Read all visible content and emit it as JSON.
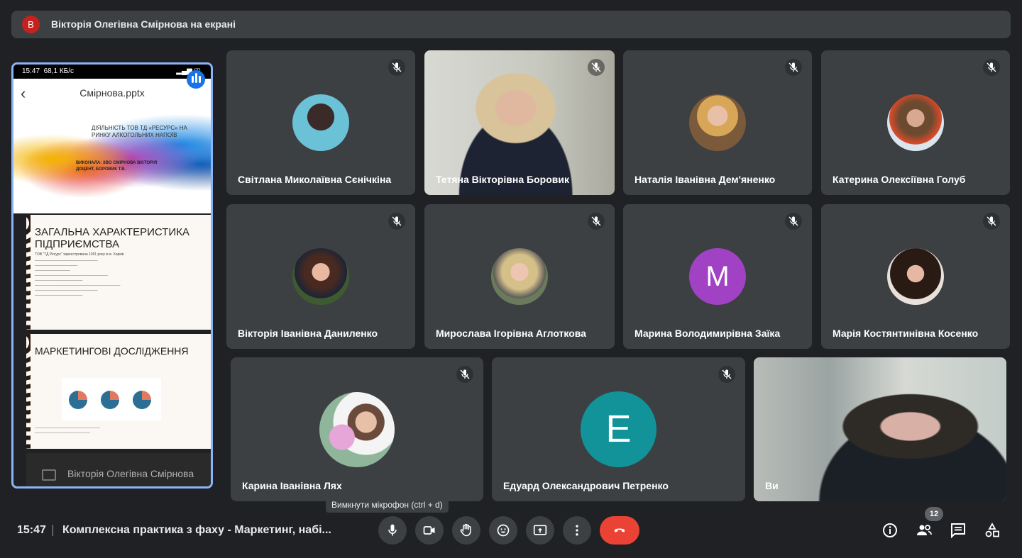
{
  "banner": {
    "avatar_letter": "В",
    "title": "Вікторія Олегівна Смірнова на екрані"
  },
  "presenter": {
    "phone_time": "15:47",
    "phone_speed": "68,1 КБ/с",
    "file_name": "Смірнова.pptx",
    "slide1_title": "ДІЯЛЬНІСТЬ ТОВ ТД «РЕСУРС» НА РИНКУ АЛКОГОЛЬНИХ НАПОЇВ",
    "slide1_author": "ВИКОНАЛА: ЗВО СМІРНОВА ВІКТОРІЯ ДОЦЕНТ, БОРОВИК Т.В.",
    "slide2_title": "ЗАГАЛЬНА ХАРАКТЕРИСТИКА ПІДПРИЄМСТВА",
    "slide2_text": "ТОВ \"ТД Ресурс\" зареєстрована 1991 року в м. Харків",
    "slide3_title": "МАРКЕТИНГОВІ ДОСЛІДЖЕННЯ",
    "name": "Вікторія Олегівна Смірнова"
  },
  "participants": [
    {
      "name": "Світлана Миколаївна Сєнічкіна",
      "avatar": "photo",
      "color": "#4a90a4"
    },
    {
      "name": "Тетяна Вікторівна Боровик",
      "avatar": "video",
      "color": "#c9b9a1"
    },
    {
      "name": "Наталія Іванівна Дем'яненко",
      "avatar": "photo",
      "color": "#d8a657"
    },
    {
      "name": "Катерина Олексіївна Голуб",
      "avatar": "photo",
      "color": "#8a6d52"
    },
    {
      "name": "Вікторія Іванівна Даниленко",
      "avatar": "photo",
      "color": "#3e5b2f"
    },
    {
      "name": "Мирослава Ігорівна Аглоткова",
      "avatar": "photo",
      "color": "#cbb9a0"
    },
    {
      "name": "Марина Володимирівна Заїка",
      "avatar": "letter",
      "letter": "М",
      "color": "#a142c4"
    },
    {
      "name": "Марія Костянтинівна Косенко",
      "avatar": "photo",
      "color": "#4d3b32"
    },
    {
      "name": "Карина Іванівна Лях",
      "avatar": "photo",
      "color": "#8fb59a"
    },
    {
      "name": "Едуард Олександрович Петренко",
      "avatar": "letter",
      "letter": "Е",
      "color": "#12939a"
    },
    {
      "name": "Ви",
      "avatar": "video",
      "color": "#7f8a8c"
    }
  ],
  "tooltip": "Вимкнути мікрофон (ctrl + d)",
  "bottom": {
    "time": "15:47",
    "meeting_title": "Комплексна практика з фаху - Маркетинг, набі...",
    "participants_count": "12"
  }
}
